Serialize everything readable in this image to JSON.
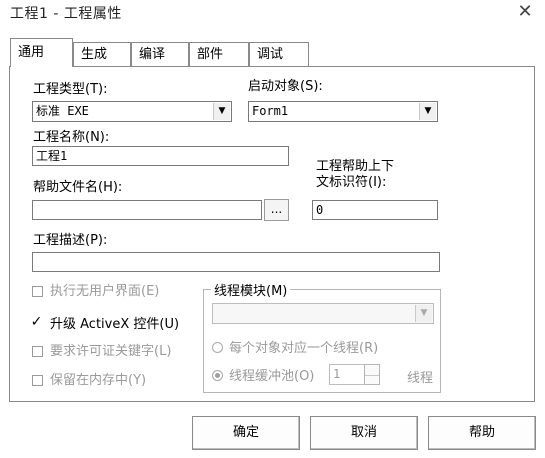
{
  "window": {
    "title": "工程1 - 工程属性",
    "close_glyph": "✕"
  },
  "tabs": [
    {
      "label": "通用",
      "active": true
    },
    {
      "label": "生成"
    },
    {
      "label": "编译"
    },
    {
      "label": "部件"
    },
    {
      "label": "调试"
    }
  ],
  "general": {
    "project_type_label": "工程类型(T):",
    "project_type_value": "标准 EXE",
    "startup_label": "启动对象(S):",
    "startup_value": "Form1",
    "project_name_label": "工程名称(N):",
    "project_name_value": "工程1",
    "help_file_label": "帮助文件名(H):",
    "help_file_value": "",
    "browse_label": "...",
    "help_context_label_1": "工程帮助上下",
    "help_context_label_2": "文标识符(I):",
    "help_context_value": "0",
    "description_label": "工程描述(P):",
    "description_value": ""
  },
  "options": {
    "unattended": {
      "label": "执行无用户界面(E)",
      "checked": false,
      "enabled": false
    },
    "upgrade_activex": {
      "label": "升级 ActiveX 控件(U)",
      "checked": true,
      "enabled": true,
      "mark": "✓"
    },
    "require_license": {
      "label": "要求许可证关键字(L)",
      "checked": false,
      "enabled": false
    },
    "retain_memory": {
      "label": "保留在内存中(Y)",
      "checked": false,
      "enabled": false
    }
  },
  "threading": {
    "title": "线程模块(M)",
    "model_value": "",
    "per_object_label": "每个对象对应一个线程(R)",
    "pool_label": "线程缓冲池(O)",
    "pool_value": "1",
    "pool_unit": "线程"
  },
  "buttons": {
    "ok": "确定",
    "cancel": "取消",
    "help": "帮助"
  }
}
